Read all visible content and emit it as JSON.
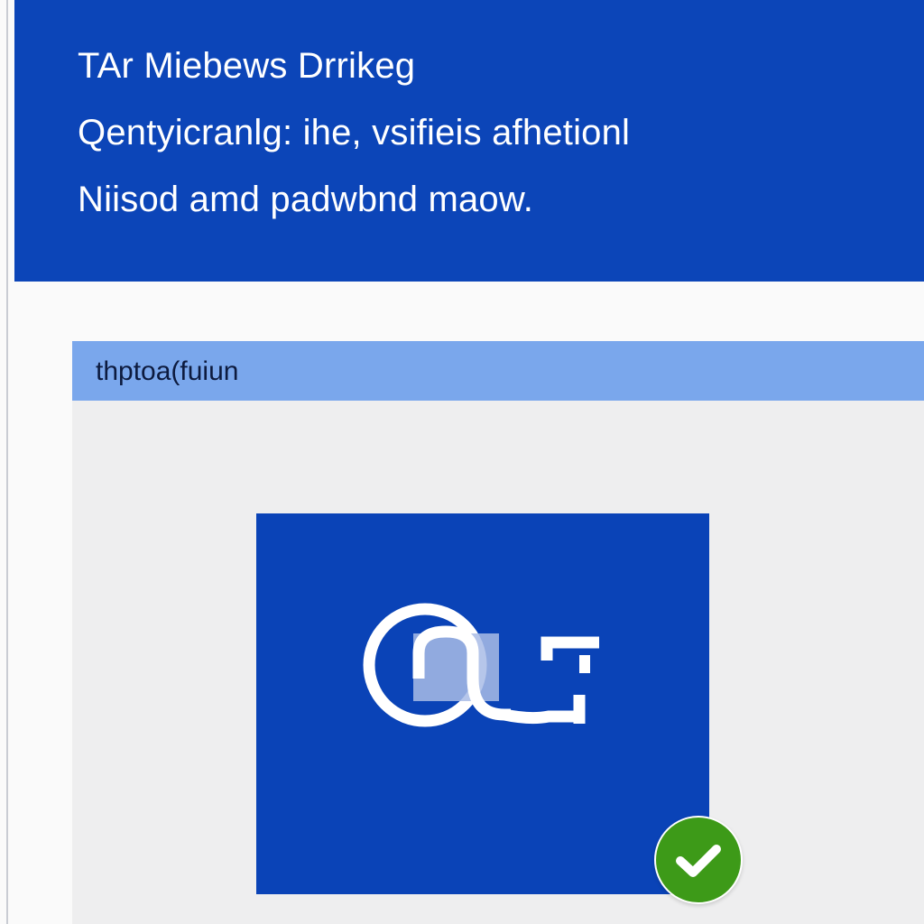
{
  "header": {
    "title": "TAr Miebews Drrikeg",
    "line2": "Qentyicranlg: ihe, vsifieis afhetionl",
    "line3": "Niisod amd padwbnd maow."
  },
  "panel": {
    "title": "thptoa(fuiun"
  },
  "icons": {
    "logo": "brand-logo-icon",
    "status": "checkmark-icon"
  },
  "colors": {
    "header_bg": "#0c45b8",
    "panel_header_bg": "#7aa7ec",
    "tile_bg": "#0a43b7",
    "success": "#3d9a18"
  }
}
